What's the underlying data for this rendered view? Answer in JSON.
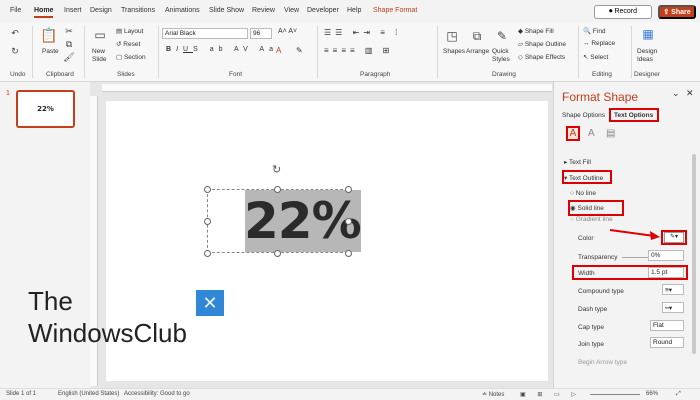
{
  "menu": {
    "tabs": [
      "File",
      "Home",
      "Insert",
      "Design",
      "Transitions",
      "Animations",
      "Slide Show",
      "Review",
      "View",
      "Developer",
      "Help",
      "Shape Format"
    ],
    "record_label": "Record",
    "share_label": "Share"
  },
  "ribbon": {
    "groups": {
      "undo": "Undo",
      "clipboard": "Clipboard",
      "slides": "Slides",
      "font": "Font",
      "paragraph": "Paragraph",
      "drawing": "Drawing",
      "editing": "Editing",
      "designer": "Designer"
    },
    "paste_label": "Paste",
    "new_slide_label": "New Slide",
    "layout_label": "Layout",
    "reset_label": "Reset",
    "section_label": "Section",
    "font_name": "Arial Black",
    "font_size": "96",
    "shapes_label": "Shapes",
    "arrange_label": "Arrange",
    "quick_styles_label": "Quick Styles",
    "shape_fill_label": "Shape Fill",
    "shape_outline_label": "Shape Outline",
    "shape_effects_label": "Shape Effects",
    "find_label": "Find",
    "replace_label": "Replace",
    "select_label": "Select",
    "design_ideas_label": "Design Ideas"
  },
  "thumbnail": {
    "slide_number": "1",
    "text": "22%"
  },
  "slide": {
    "text": "22%"
  },
  "pane": {
    "title": "Format Shape",
    "tab_shape_options": "Shape Options",
    "tab_text_options": "Text Options",
    "text_fill": "Text Fill",
    "text_outline": "Text Outline",
    "no_line": "No line",
    "solid_line": "Solid line",
    "gradient_line": "Gradient line",
    "color": "Color",
    "transparency": "Transparency",
    "transparency_value": "0%",
    "width": "Width",
    "width_value": "1.5 pt",
    "compound_type": "Compound type",
    "dash_type": "Dash type",
    "cap_type": "Cap type",
    "cap_type_value": "Flat",
    "join_type": "Join type",
    "join_type_value": "Round",
    "begin_arrow_type": "Begin Arrow type"
  },
  "watermark": {
    "line1": "The",
    "line2": "WindowsClub"
  },
  "status": {
    "slide_info": "Slide 1 of 1",
    "language": "English (United States)",
    "accessibility": "Accessibility: Good to go",
    "notes": "Notes",
    "zoom": "66%"
  },
  "colors": {
    "accent": "#c43e1c",
    "highlight_red": "#dd0000",
    "text_highlight": "#b7b7b7"
  }
}
